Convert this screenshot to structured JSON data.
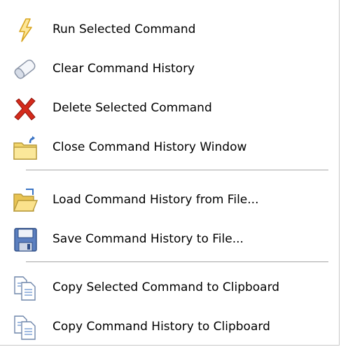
{
  "menu": {
    "items": [
      {
        "label": "Run Selected Command",
        "icon": "lightning-icon"
      },
      {
        "label": "Clear Command History",
        "icon": "eraser-icon"
      },
      {
        "label": "Delete Selected Command",
        "icon": "delete-x-icon"
      },
      {
        "label": "Close Command History Window",
        "icon": "folder-close-icon"
      },
      {
        "label": "Load Command History from File...",
        "icon": "folder-open-icon"
      },
      {
        "label": "Save Command History to File...",
        "icon": "floppy-disk-icon"
      },
      {
        "label": "Copy Selected Command to Clipboard",
        "icon": "copy-icon"
      },
      {
        "label": "Copy Command History to Clipboard",
        "icon": "copy-icon"
      }
    ]
  },
  "colors": {
    "text": "#000000",
    "separator": "#a6a6a6",
    "delete_red": "#d42b1c",
    "folder_yellow": "#f2d56a",
    "floppy_blue": "#5b7fbf"
  }
}
